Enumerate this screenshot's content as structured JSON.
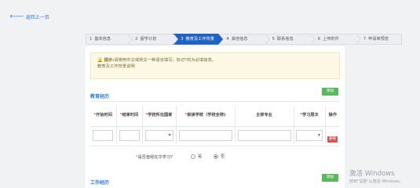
{
  "nav": {
    "back_label": "返回上一页"
  },
  "steps": [
    {
      "num": "1",
      "label": "基本信息",
      "active": false
    },
    {
      "num": "2",
      "label": "留学计划",
      "active": false
    },
    {
      "num": "3",
      "label": "教育及工作背景",
      "active": true
    },
    {
      "num": "4",
      "label": "其他信息",
      "active": false
    },
    {
      "num": "5",
      "label": "联系信息",
      "active": false
    },
    {
      "num": "6",
      "label": "上传附件",
      "active": false
    },
    {
      "num": "7",
      "label": "申请单预览",
      "active": false
    }
  ],
  "notice": {
    "label": "提示:",
    "line1": "请使用中文或英文一种语言填写。标记*的为必填信息。",
    "line2": "教育及工作背景说明"
  },
  "education": {
    "title": "教育经历",
    "add_label": "添加",
    "headers": [
      {
        "req": "*",
        "text": "开始时间"
      },
      {
        "req": "*",
        "text": "结束时间"
      },
      {
        "req": "*",
        "text": "学校所在国家"
      },
      {
        "req": "*",
        "text": "就读学校（学校全称)"
      },
      {
        "req": "",
        "text": "主修专业"
      },
      {
        "req": "*",
        "text": "学习层次"
      },
      {
        "req": "",
        "text": "操作"
      }
    ],
    "delete_label": "删除"
  },
  "studying": {
    "question": "是否曾经在华学习?",
    "required_mark": "*",
    "options": [
      {
        "label": "是",
        "checked": false
      },
      {
        "label": "否",
        "checked": true
      }
    ]
  },
  "work": {
    "title": "工作经历",
    "add_label": "添加"
  },
  "watermark": {
    "line1": "激活 Windows",
    "line2": "转到\"设置\"以激活 Windows。"
  }
}
